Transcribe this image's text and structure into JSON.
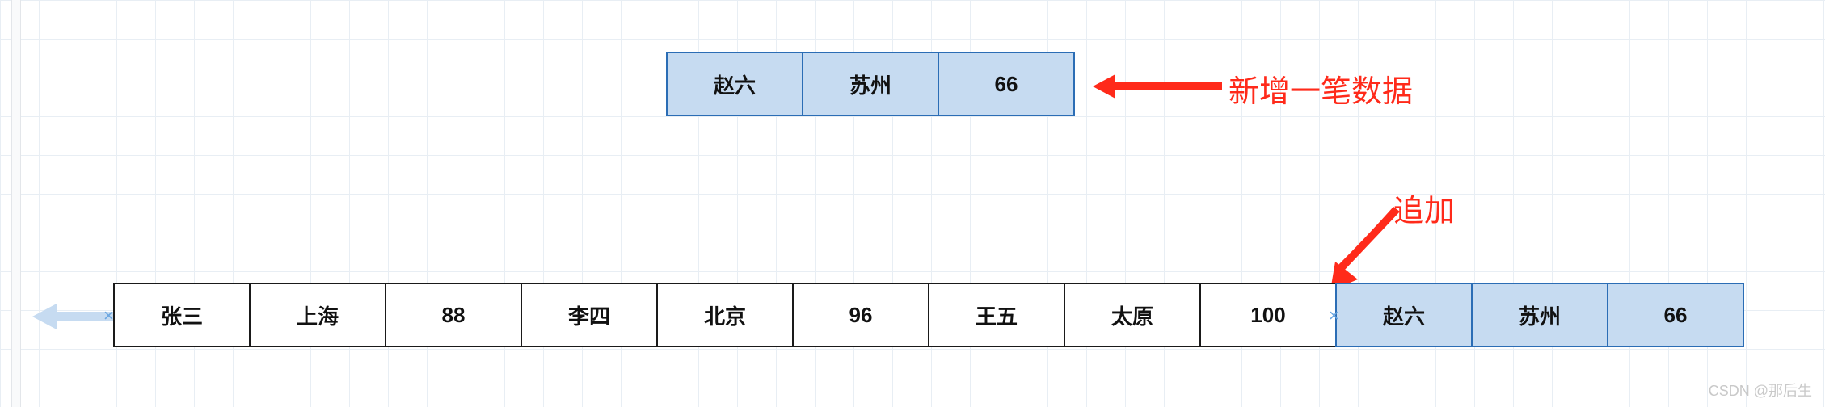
{
  "new_record": {
    "cells": [
      "赵六",
      "苏州",
      "66"
    ]
  },
  "main_row": {
    "existing": [
      "张三",
      "上海",
      "88",
      "李四",
      "北京",
      "96",
      "王五",
      "太原",
      "100"
    ],
    "appended": [
      "赵六",
      "苏州",
      "66"
    ]
  },
  "labels": {
    "new_data": "新增一笔数据",
    "append": "追加"
  },
  "watermark": "CSDN @那后生",
  "colors": {
    "cell_blue_fill": "#c6dbf1",
    "cell_blue_border": "#2b6db5",
    "cell_white_border": "#1a1a1a",
    "label_red": "#ff2a1a",
    "light_arrow": "#c6dbf1"
  }
}
